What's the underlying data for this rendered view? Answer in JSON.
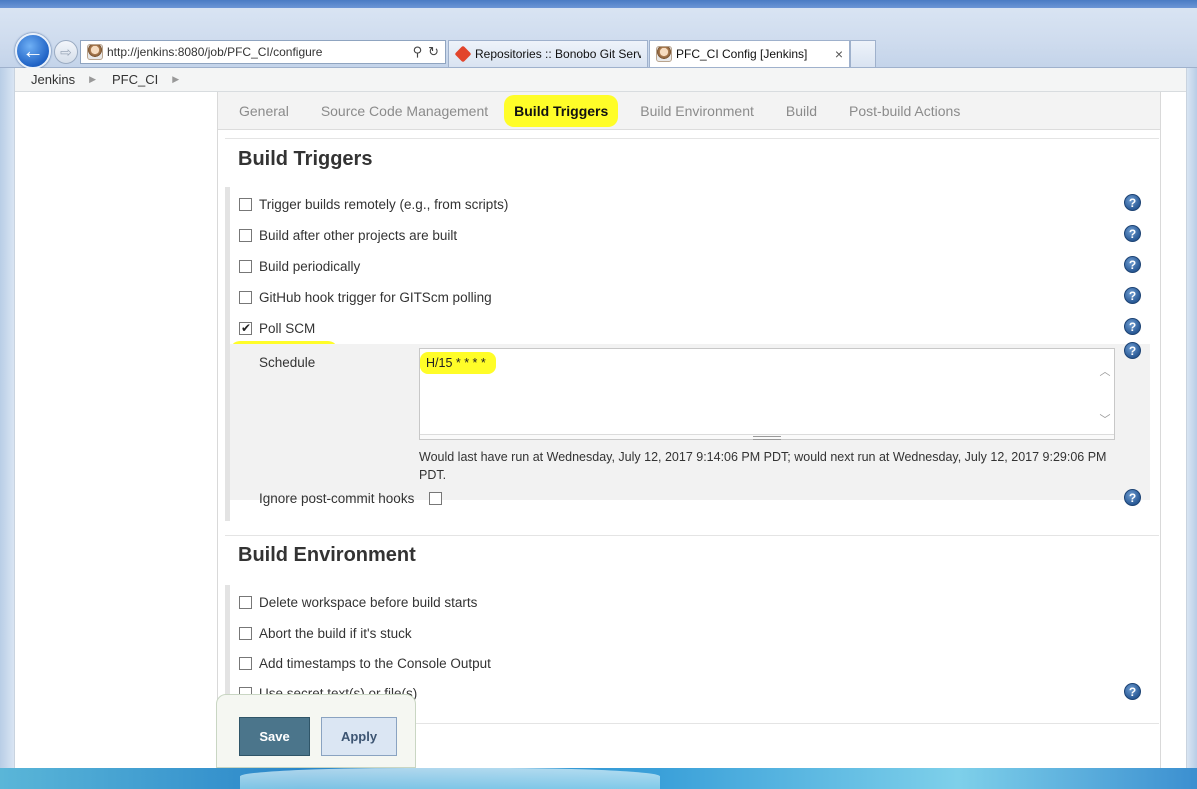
{
  "browser": {
    "address_url": "http://jenkins:8080/job/PFC_CI/configure",
    "tabs": [
      {
        "label": "Repositories :: Bonobo Git Serv..."
      },
      {
        "label": "PFC_CI Config [Jenkins]"
      }
    ],
    "close_glyph": "×",
    "search_glyph": "⚲",
    "refresh_glyph": "↻",
    "back_glyph": "←",
    "forward_glyph": "⇨"
  },
  "breadcrumb": [
    "Jenkins",
    "PFC_CI"
  ],
  "config_tabs": [
    {
      "label": "General",
      "active": false
    },
    {
      "label": "Source Code Management",
      "active": false
    },
    {
      "label": "Build Triggers",
      "active": true
    },
    {
      "label": "Build Environment",
      "active": false
    },
    {
      "label": "Build",
      "active": false
    },
    {
      "label": "Post-build Actions",
      "active": false
    }
  ],
  "build_triggers": {
    "title": "Build Triggers",
    "options": [
      {
        "label": "Trigger builds remotely (e.g., from scripts)",
        "checked": false
      },
      {
        "label": "Build after other projects are built",
        "checked": false
      },
      {
        "label": "Build periodically",
        "checked": false
      },
      {
        "label": "GitHub hook trigger for GITScm polling",
        "checked": false
      },
      {
        "label": "Poll SCM",
        "checked": true
      }
    ],
    "schedule_label": "Schedule",
    "schedule_value": "H/15 * * * *",
    "schedule_info": "Would last have run at Wednesday, July 12, 2017 9:14:06 PM PDT; would next run at Wednesday, July 12, 2017 9:29:06 PM PDT.",
    "ignore_hooks_label": "Ignore post-commit hooks",
    "ignore_hooks_checked": false
  },
  "build_environment": {
    "title": "Build Environment",
    "options": [
      {
        "label": "Delete workspace before build starts",
        "checked": false
      },
      {
        "label": "Abort the build if it's stuck",
        "checked": false
      },
      {
        "label": "Add timestamps to the Console Output",
        "checked": false
      },
      {
        "label": "Use secret text(s) or file(s)",
        "checked": false
      }
    ]
  },
  "buttons": {
    "save": "Save",
    "apply": "Apply"
  },
  "help_glyph": "?",
  "colors": {
    "highlight": "#fffd28",
    "save_button": "#4b758b",
    "apply_button": "#dbe6f3"
  }
}
